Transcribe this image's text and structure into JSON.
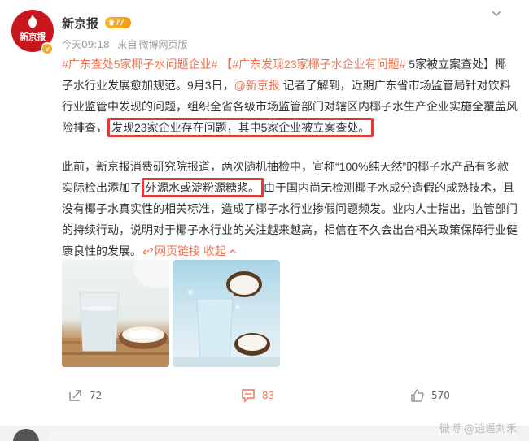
{
  "post": {
    "author": "新京报",
    "level": "IV",
    "timestamp": "今天09:18",
    "source_prefix": "来自",
    "source": "微博网页版",
    "avatar_logo": "新京报",
    "vbadge": "v"
  },
  "content": {
    "p1_tag1": "#广东查处5家椰子水问题企业#",
    "p1_tag2": "【#广东发现23家椰子水企业有问题#",
    "p1_a": " 5家被立案查处】椰子水行业发展愈加规范。9月3日，",
    "p1_mention": "@新京报",
    "p1_b": " 记者了解到，近期广东省市场监管局针对饮料行业监管中发现的问题，组织全省各级市场监管部门对辖区内椰子水生产企业实施全覆盖风险排查，",
    "p1_highlight": "发现23家企业存在问题，其中5家企业被立案查处。",
    "p2_a": "此前，新京报消费研究院报道，两次随机抽检中，宣称“100%纯天然”的椰子水产品有多款实际检出添加了",
    "p2_highlight": "外源水或淀粉源糖浆。",
    "p2_b": "由于国内尚无检测椰子水成分造假的成熟技术，且没有椰子水真实性的相关标准，造成了椰子水行业掺假问题频发。业内人士指出，监管部门的持续行动，说明对于椰子水行业的关注越来越高，相信在不久会出台相关政策保障行业健康良性的发展。",
    "web_link": "网页链接",
    "collapse": "收起"
  },
  "actions": {
    "repost_count": "72",
    "comment_count": "83",
    "like_count": "570"
  },
  "watermark": "微博 @逍遥刘禾",
  "colors": {
    "accent": "#eb7350",
    "highlight_border": "#e03b3b",
    "brand": "#c8161d"
  }
}
